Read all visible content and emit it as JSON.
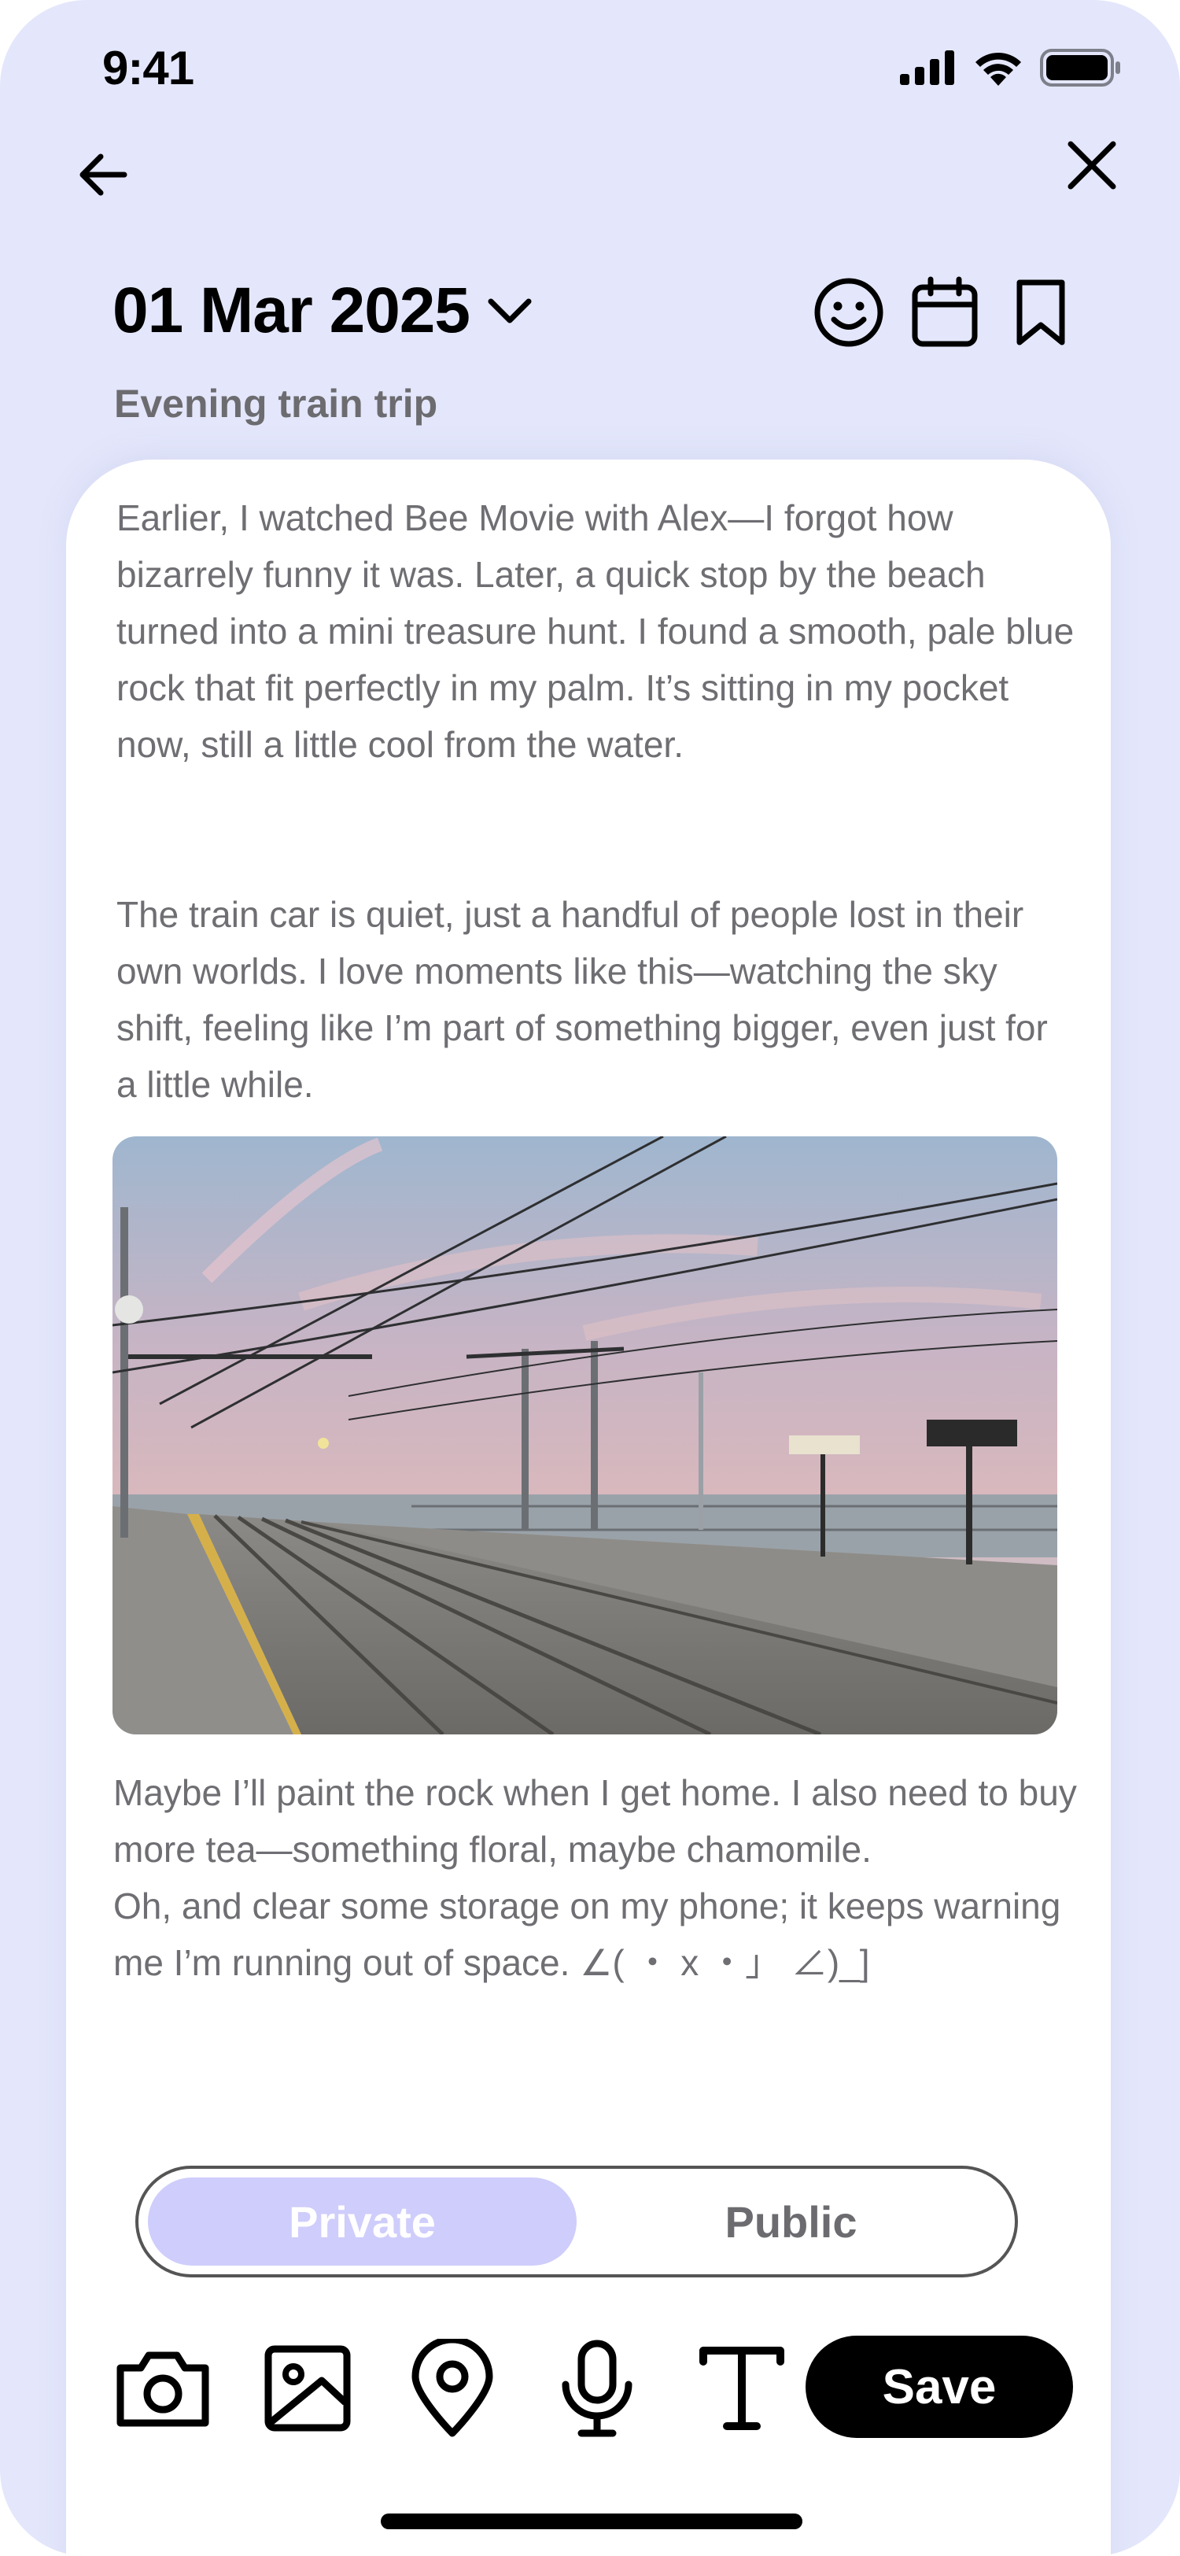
{
  "status_bar": {
    "time": "9:41",
    "icons": [
      "cellular-signal-icon",
      "wifi-icon",
      "battery-icon"
    ]
  },
  "nav": {
    "back_icon": "arrow-left-icon",
    "close_icon": "close-icon"
  },
  "header": {
    "date": "01 Mar 2025",
    "date_icon": "chevron-down-icon",
    "actions": [
      "smiley-icon",
      "calendar-icon",
      "bookmark-icon"
    ],
    "title": "Evening train trip"
  },
  "entry": {
    "paragraph1": "Earlier, I watched Bee Movie with Alex—I forgot how bizarrely funny it was. Later, a quick stop by the beach turned into a mini treasure hunt. I found a smooth, pale blue rock that fit perfectly in my palm. It’s sitting in my pocket now, still a little cool from the water.",
    "paragraph2": "The train car is quiet, just a handful of people lost in their own worlds. I love moments like this—watching the sky shift, feeling like I’m part of something bigger, even just for a little while.",
    "paragraph3_line1": "Maybe I’ll paint the rock when I get home. I also need to buy more tea—something floral, maybe chamomile.",
    "paragraph3_line2": "Oh, and clear some storage on my phone; it keeps warning me I’m running out of space.  ∠( ・ x ・」 ∠)_]"
  },
  "visibility": {
    "options": [
      "Private",
      "Public"
    ],
    "selected": "Private",
    "active_color": "#cfcdfb"
  },
  "toolbar": {
    "tools": [
      "camera-icon",
      "image-icon",
      "location-pin-icon",
      "microphone-icon",
      "text-icon"
    ],
    "save_label": "Save"
  },
  "colors": {
    "background": "#e4e7fb",
    "card": "#ffffff",
    "body_text": "#6e6e73"
  }
}
